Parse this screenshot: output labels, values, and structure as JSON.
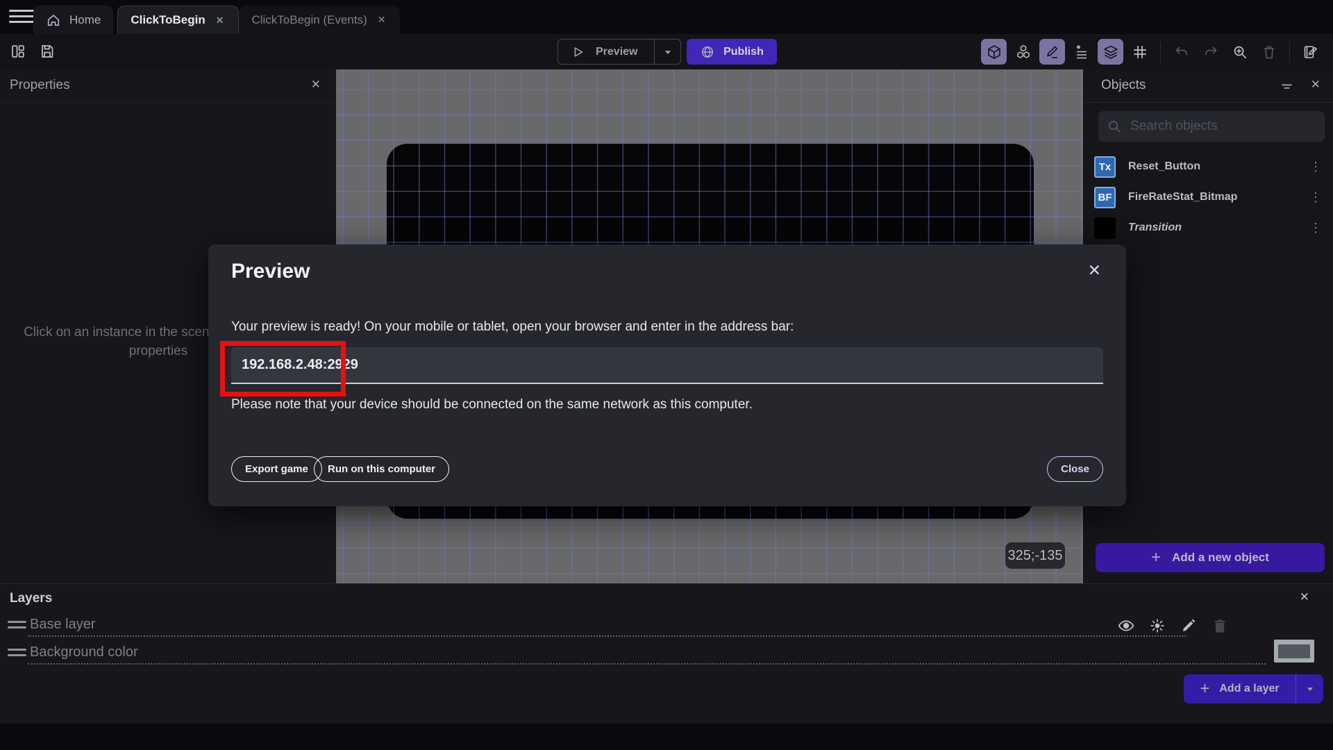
{
  "tabbar": {
    "tabs": [
      {
        "label": "Home"
      },
      {
        "label": "ClickToBegin"
      },
      {
        "label": "ClickToBegin (Events)"
      }
    ]
  },
  "toolbar": {
    "preview_label": "Preview",
    "publish_label": "Publish"
  },
  "properties_panel": {
    "title": "Properties",
    "placeholder": "Click on an instance in the scene to display its properties"
  },
  "canvas": {
    "coords_badge": "325;-135"
  },
  "objects_panel": {
    "title": "Objects",
    "search_placeholder": "Search objects",
    "items": [
      {
        "name": "Reset_Button",
        "badge": "Tx"
      },
      {
        "name": "FireRateStat_Bitmap",
        "badge": "BF"
      },
      {
        "name": "Transition",
        "badge": ""
      }
    ],
    "add_button_label": "Add a new object"
  },
  "modal": {
    "title": "Preview",
    "body": "Your preview is ready! On your mobile or tablet, open your browser and enter in the address bar:",
    "address": "192.168.2.48:2929",
    "note": "Please note that your device should be connected on the same network as this computer.",
    "export_label": "Export game",
    "run_label": "Run on this computer",
    "close_label": "Close"
  },
  "layers_panel": {
    "title": "Layers",
    "rows": [
      {
        "name": "Base layer"
      },
      {
        "name": "Background color"
      }
    ],
    "add_button_label": "Add a layer"
  },
  "colors": {
    "publish_purple": "#4226b8",
    "add_button_purple": "#37199f",
    "annotation_red": "#e51111",
    "canvas_gray": "#69696b",
    "active_tool_bg": "#7b74a3"
  }
}
